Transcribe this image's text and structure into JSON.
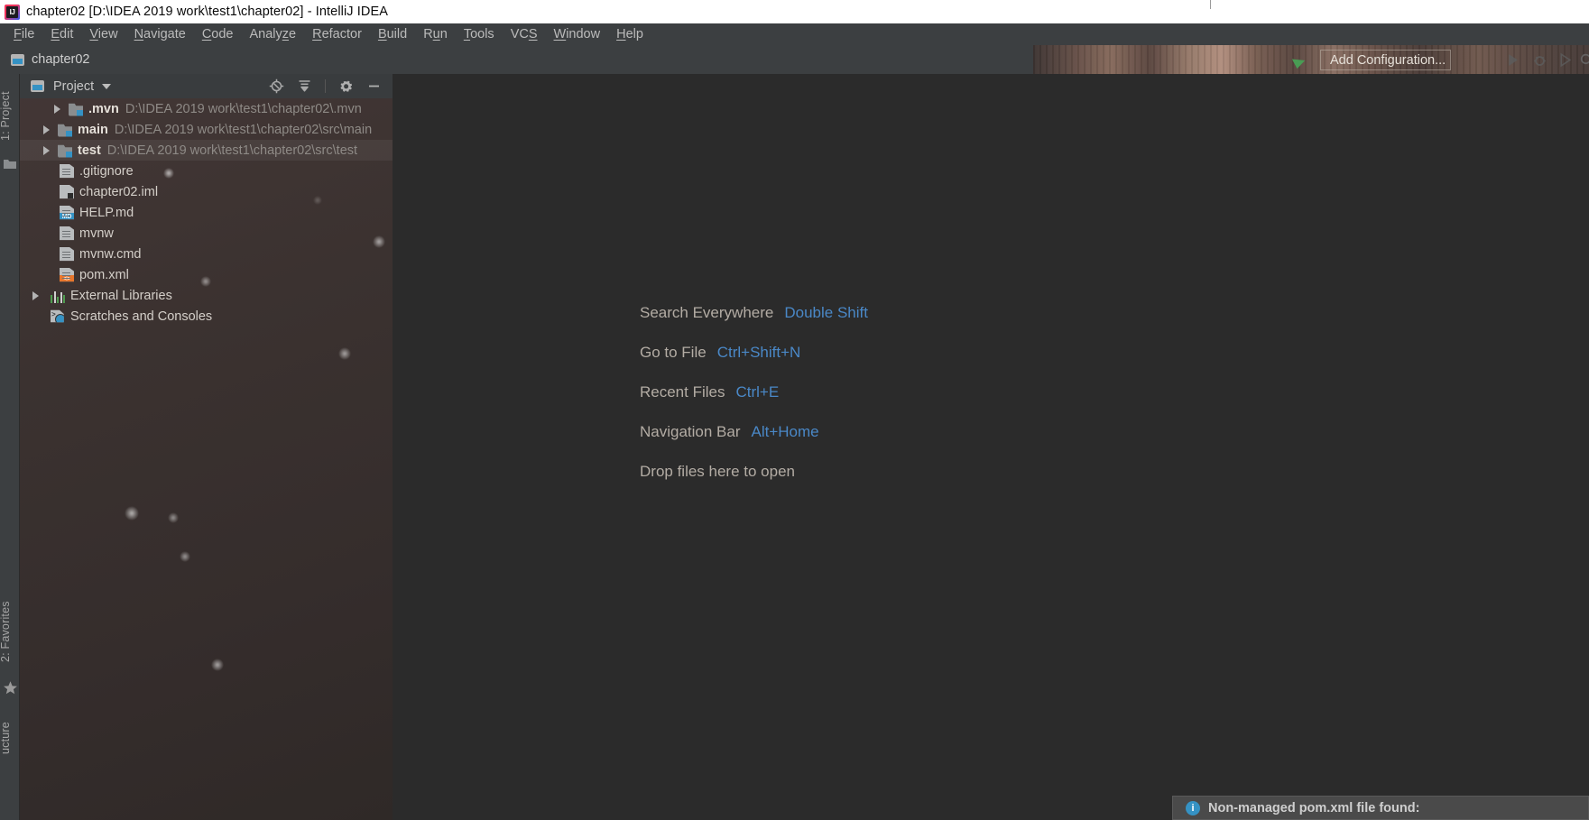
{
  "window": {
    "title": "chapter02 [D:\\IDEA 2019 work\\test1\\chapter02] - IntelliJ IDEA",
    "logo_icon": "intellij-idea-logo",
    "logo_text": "IJ"
  },
  "menubar": {
    "items": [
      {
        "label": "File",
        "mnemonic": "F"
      },
      {
        "label": "Edit",
        "mnemonic": "E"
      },
      {
        "label": "View",
        "mnemonic": "V"
      },
      {
        "label": "Navigate",
        "mnemonic": "N"
      },
      {
        "label": "Code",
        "mnemonic": "C"
      },
      {
        "label": "Analyze",
        "mnemonic": "z"
      },
      {
        "label": "Refactor",
        "mnemonic": "R"
      },
      {
        "label": "Build",
        "mnemonic": "B"
      },
      {
        "label": "Run",
        "mnemonic": "u"
      },
      {
        "label": "Tools",
        "mnemonic": "T"
      },
      {
        "label": "VCS",
        "mnemonic": "S"
      },
      {
        "label": "Window",
        "mnemonic": "W"
      },
      {
        "label": "Help",
        "mnemonic": "H"
      }
    ]
  },
  "toolbar": {
    "project_chip": "chapter02",
    "project_chip_icon": "project-module-icon",
    "add_configuration": "Add Configuration...",
    "green_arrow_icon": "green-arrow-pointer-icon",
    "run_icon": "run-icon",
    "debug_icon": "debug-icon",
    "coverage_icon": "run-with-coverage-icon",
    "search_icon": "search-icon"
  },
  "left_rail": {
    "project_tab": "1: Project",
    "project_tab_mnemonic": "1",
    "favorites_tab": "2: Favorites",
    "favorites_tab_mnemonic": "2",
    "structure_tab": "ucture",
    "folder_icon": "folder-icon",
    "star_icon": "star-icon"
  },
  "project_panel": {
    "title": "Project",
    "title_icon": "project-view-icon",
    "dropdown_icon": "chevron-down-icon",
    "actions": [
      {
        "name": "locate-icon",
        "title": "Select Opened File"
      },
      {
        "name": "collapse-all-icon",
        "title": "Collapse All"
      },
      {
        "name": "gear-icon",
        "title": "Settings"
      },
      {
        "name": "minimize-icon",
        "title": "Hide"
      }
    ],
    "tree": [
      {
        "label": ".mvn",
        "path": "D:\\IDEA 2019 work\\test1\\chapter02\\.mvn",
        "icon": "module-folder-icon",
        "expandable": true,
        "bold": true,
        "selected": false
      },
      {
        "label": "main",
        "path": "D:\\IDEA 2019 work\\test1\\chapter02\\src\\main",
        "icon": "module-folder-icon",
        "expandable": true,
        "bold": true,
        "selected": false
      },
      {
        "label": "test",
        "path": "D:\\IDEA 2019 work\\test1\\chapter02\\src\\test",
        "icon": "module-folder-icon",
        "expandable": true,
        "bold": true,
        "selected": true
      },
      {
        "label": ".gitignore",
        "path": "",
        "icon": "text-file-icon",
        "expandable": false,
        "bold": false,
        "selected": false
      },
      {
        "label": "chapter02.iml",
        "path": "",
        "icon": "iml-file-icon",
        "expandable": false,
        "bold": false,
        "selected": false
      },
      {
        "label": "HELP.md",
        "path": "",
        "icon": "markdown-file-icon",
        "badge": "MD",
        "expandable": false,
        "bold": false,
        "selected": false
      },
      {
        "label": "mvnw",
        "path": "",
        "icon": "text-file-icon",
        "expandable": false,
        "bold": false,
        "selected": false
      },
      {
        "label": "mvnw.cmd",
        "path": "",
        "icon": "text-file-icon",
        "expandable": false,
        "bold": false,
        "selected": false
      },
      {
        "label": "pom.xml",
        "path": "",
        "icon": "xml-file-icon",
        "badge": "<>",
        "expandable": false,
        "bold": false,
        "selected": false
      },
      {
        "label": "External Libraries",
        "path": "",
        "icon": "libraries-icon",
        "expandable": true,
        "bold": false,
        "selected": false
      },
      {
        "label": "Scratches and Consoles",
        "path": "",
        "icon": "scratches-icon",
        "expandable": false,
        "bold": false,
        "selected": false
      }
    ]
  },
  "editor": {
    "hints": [
      {
        "label": "Search Everywhere",
        "shortcut": "Double Shift"
      },
      {
        "label": "Go to File",
        "shortcut": "Ctrl+Shift+N"
      },
      {
        "label": "Recent Files",
        "shortcut": "Ctrl+E"
      },
      {
        "label": "Navigation Bar",
        "shortcut": "Alt+Home"
      },
      {
        "label": "Drop files here to open",
        "shortcut": ""
      }
    ]
  },
  "notification": {
    "icon": "info-icon",
    "icon_glyph": "i",
    "text": "Non-managed pom.xml file found:"
  },
  "colors": {
    "accent_blue": "#3592c4",
    "hint_key": "#4a88c7",
    "panel_bg": "#3c3331",
    "editor_bg": "#2b2b2b",
    "chrome_bg": "#3c3f41",
    "xml_badge": "#e8762c"
  }
}
